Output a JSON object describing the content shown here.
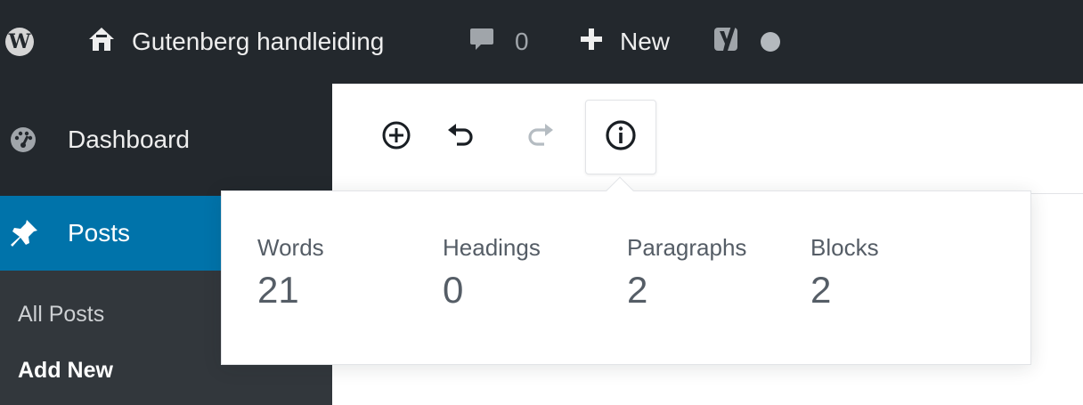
{
  "admin_bar": {
    "wp_logo_letter": "W",
    "site_name": "Gutenberg handleiding",
    "comments_count": "0",
    "new_label": "New",
    "icons": {
      "wp": "wordpress-logo-icon",
      "home": "home-icon",
      "comment": "comment-bubble-icon",
      "new": "plus-icon",
      "yoast": "yoast-logo-icon",
      "status": "status-dot-icon"
    }
  },
  "sidebar": {
    "dashboard_label": "Dashboard",
    "posts_label": "Posts",
    "submenu": {
      "all_posts": "All Posts",
      "add_new": "Add New"
    },
    "icons": {
      "dashboard": "dashboard-gauge-icon",
      "posts": "pushpin-icon"
    }
  },
  "toolbar": {
    "buttons": [
      {
        "name": "inserter",
        "icon": "plus-circle-icon"
      },
      {
        "name": "undo",
        "icon": "undo-icon"
      },
      {
        "name": "redo",
        "icon": "redo-icon"
      },
      {
        "name": "content-info",
        "icon": "info-icon"
      }
    ]
  },
  "content_info": {
    "words_label": "Words",
    "words_value": "21",
    "headings_label": "Headings",
    "headings_value": "0",
    "paragraphs_label": "Paragraphs",
    "paragraphs_value": "2",
    "blocks_label": "Blocks",
    "blocks_value": "2"
  },
  "colors": {
    "admin_bar_bg": "#23282d",
    "sidebar_bg": "#23282d",
    "submenu_bg": "#32373c",
    "active_menu_bg": "#0073aa",
    "text_light": "#eeeeee",
    "stat_text": "#555d66"
  }
}
